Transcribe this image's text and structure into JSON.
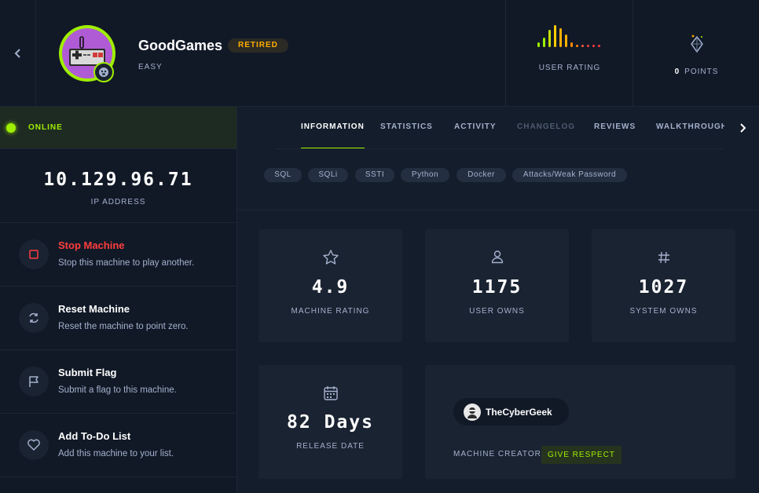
{
  "header": {
    "machine_name": "GoodGames",
    "status_badge": "RETIRED",
    "difficulty": "EASY",
    "user_rating_label": "USER RATING",
    "points_value": "0",
    "points_label": "POINTS",
    "icons": {
      "back": "chevron-left-icon",
      "avatar": "game-controller-icon",
      "os": "linux-icon",
      "rating": "rating-bars-icon",
      "points": "diamond-icon"
    }
  },
  "sidebar": {
    "status": "ONLINE",
    "ip_address": "10.129.96.71",
    "ip_label": "IP ADDRESS",
    "actions": [
      {
        "title": "Stop Machine",
        "description": "Stop this machine to play another.",
        "icon": "stop-icon"
      },
      {
        "title": "Reset Machine",
        "description": "Reset the machine to point zero.",
        "icon": "reset-icon"
      },
      {
        "title": "Submit Flag",
        "description": "Submit a flag to this machine.",
        "icon": "flag-icon"
      },
      {
        "title": "Add To-Do List",
        "description": "Add this machine to your list.",
        "icon": "heart-icon"
      }
    ]
  },
  "tabs": [
    {
      "label": "INFORMATION",
      "state": "active"
    },
    {
      "label": "STATISTICS",
      "state": "normal"
    },
    {
      "label": "ACTIVITY",
      "state": "normal"
    },
    {
      "label": "CHANGELOG",
      "state": "disabled"
    },
    {
      "label": "REVIEWS",
      "state": "normal"
    },
    {
      "label": "WALKTHROUGHS",
      "state": "normal"
    }
  ],
  "tags": [
    "SQL",
    "SQLi",
    "SSTI",
    "Python",
    "Docker",
    "Attacks/Weak Password"
  ],
  "stats": [
    {
      "value": "4.9",
      "label": "MACHINE RATING",
      "icon": "star-icon"
    },
    {
      "value": "1175",
      "label": "USER OWNS",
      "icon": "user-icon"
    },
    {
      "value": "1027",
      "label": "SYSTEM OWNS",
      "icon": "hash-icon"
    }
  ],
  "release": {
    "value": "82 Days",
    "label": "RELEASE DATE",
    "icon": "calendar-icon"
  },
  "creator": {
    "name": "TheCyberGeek",
    "label": "MACHINE CREATOR",
    "respect_button": "GIVE RESPECT"
  },
  "colors": {
    "background": "#141d2b",
    "panel": "#111927",
    "card": "#1a2332",
    "accent_green": "#9fef00",
    "accent_orange": "#ffaf00",
    "danger_red": "#ff3e3e",
    "text_muted": "#a4b1cd"
  }
}
